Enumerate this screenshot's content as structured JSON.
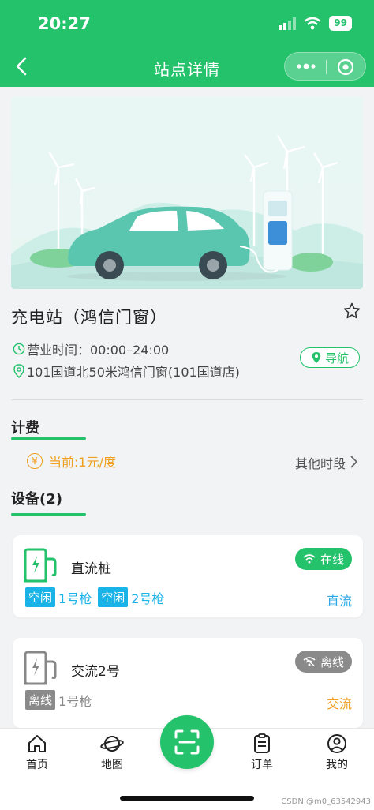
{
  "status_bar": {
    "time": "20:27",
    "battery": "99"
  },
  "nav": {
    "title": "站点详情"
  },
  "station": {
    "name": "充电站（鸿信门窗）",
    "hours": "营业时间：00:00–24:00",
    "address": "101国道北50米鸿信门窗(101国道店)",
    "navigate_label": "导航"
  },
  "pricing": {
    "title": "计费",
    "current": "当前:1元/度",
    "other_periods": "其他时段"
  },
  "devices": {
    "title": "设备(2)",
    "items": [
      {
        "name": "直流桩",
        "status": "在线",
        "status_color": "#23c26b",
        "current_type": "直流",
        "type_color": "#2aa7e8",
        "guns": [
          {
            "state": "空闲",
            "label": "1号枪",
            "color": "#1ab3e8"
          },
          {
            "state": "空闲",
            "label": "2号枪",
            "color": "#1ab3e8"
          }
        ]
      },
      {
        "name": "交流2号",
        "status": "离线",
        "status_color": "#8a8a8a",
        "current_type": "交流",
        "type_color": "#f0a020",
        "guns": [
          {
            "state": "离线",
            "label": "1号枪",
            "color": "#8a8a8a"
          }
        ]
      }
    ]
  },
  "tabbar": {
    "home": "首页",
    "map": "地图",
    "orders": "订单",
    "mine": "我的"
  },
  "watermark": "CSDN @m0_63542943",
  "colors": {
    "accent": "#23c26b",
    "price": "#f0a020"
  }
}
